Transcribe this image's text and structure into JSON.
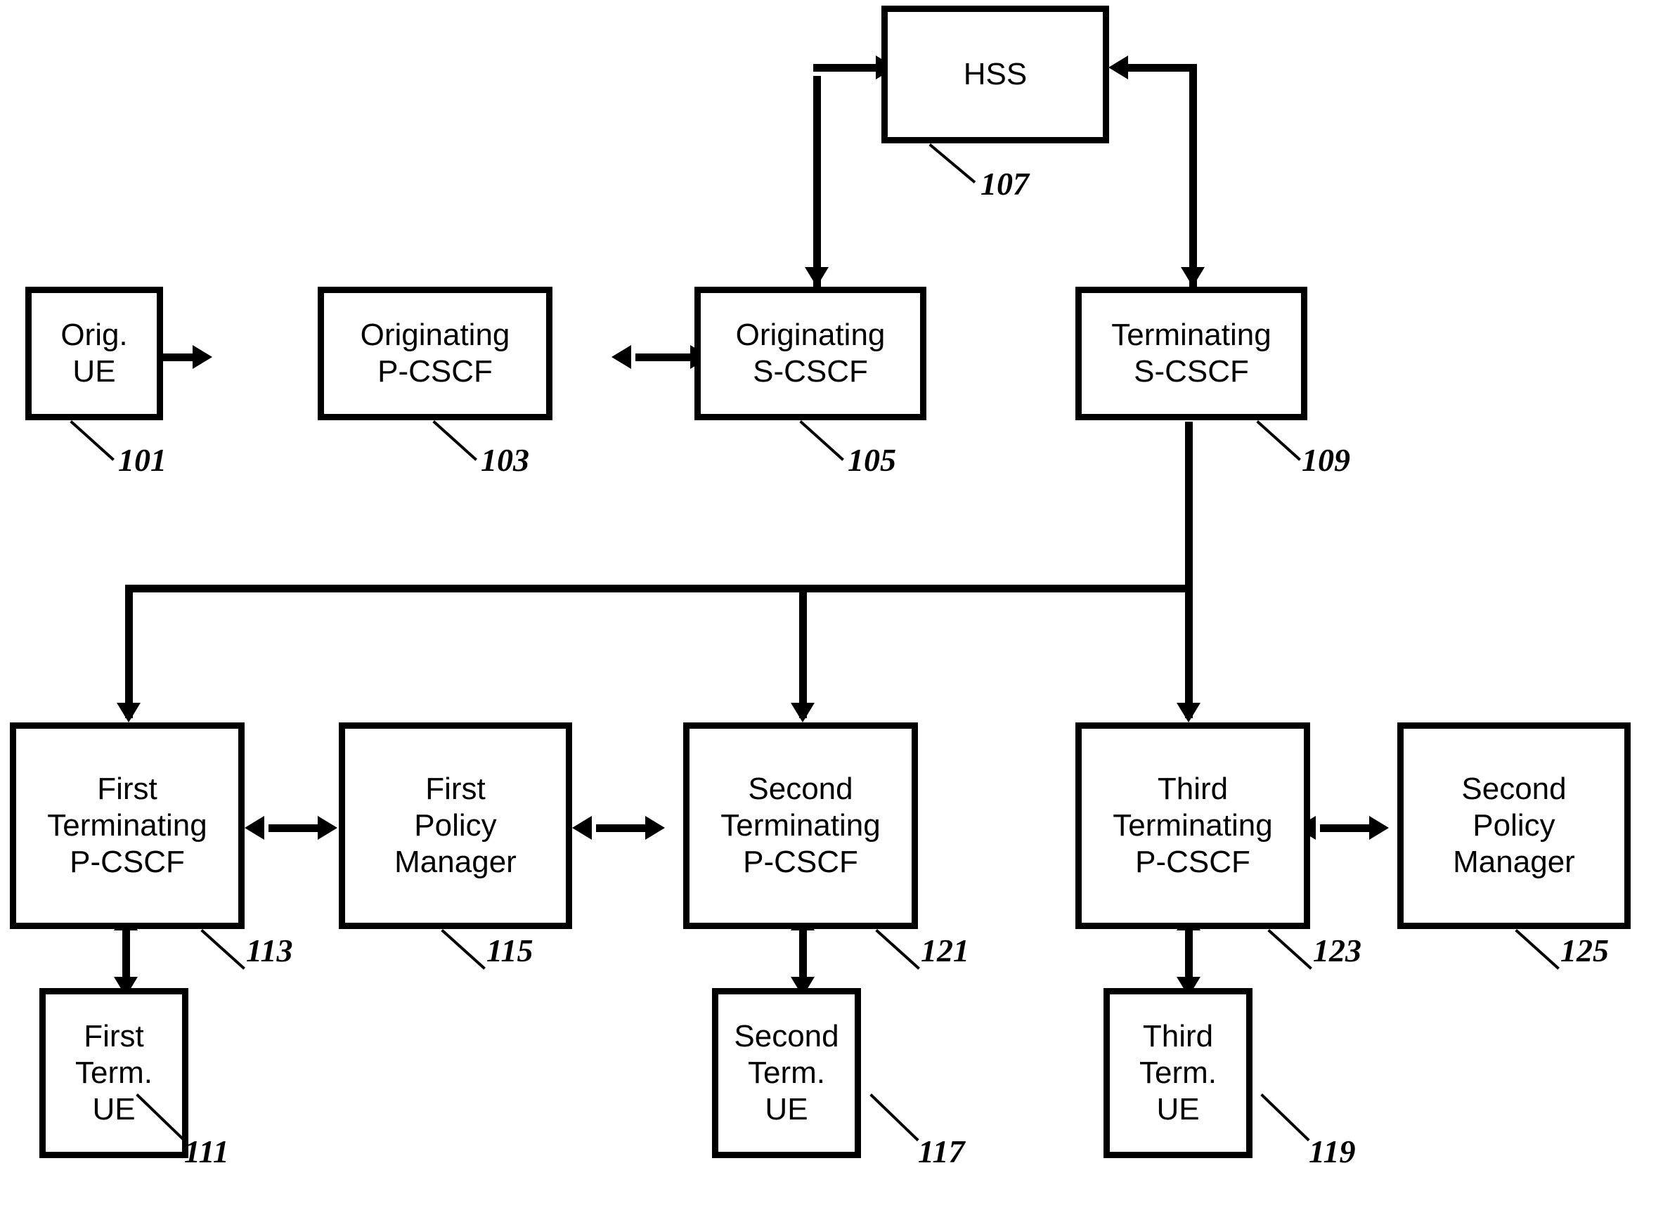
{
  "figure": {
    "type": "patent-block-diagram",
    "title": "IMS network elements block diagram"
  },
  "nodes": [
    {
      "id": "orig_ue",
      "label": "Orig.\nUE",
      "ref": "101"
    },
    {
      "id": "orig_pcscf",
      "label": "Originating\nP-CSCF",
      "ref": "103"
    },
    {
      "id": "orig_scscf",
      "label": "Originating\nS-CSCF",
      "ref": "105"
    },
    {
      "id": "hss",
      "label": "HSS",
      "ref": "107"
    },
    {
      "id": "term_scscf",
      "label": "Terminating\nS-CSCF",
      "ref": "109"
    },
    {
      "id": "first_ue",
      "label": "First\nTerm.\nUE",
      "ref": "111"
    },
    {
      "id": "first_pcscf",
      "label": "First\nTerminating\nP-CSCF",
      "ref": "113"
    },
    {
      "id": "first_pm",
      "label": "First\nPolicy\nManager",
      "ref": "115"
    },
    {
      "id": "second_ue",
      "label": "Second\nTerm.\nUE",
      "ref": "117"
    },
    {
      "id": "third_ue",
      "label": "Third\nTerm.\nUE",
      "ref": "119"
    },
    {
      "id": "second_pcscf",
      "label": "Second\nTerminating\nP-CSCF",
      "ref": "121"
    },
    {
      "id": "third_pcscf",
      "label": "Third\nTerminating\nP-CSCF",
      "ref": "123"
    },
    {
      "id": "second_pm",
      "label": "Second\nPolicy\nManager",
      "ref": "125"
    }
  ],
  "connections": [
    {
      "from": "orig_ue",
      "to": "orig_pcscf",
      "style": "bidirectional"
    },
    {
      "from": "orig_pcscf",
      "to": "orig_scscf",
      "style": "bidirectional"
    },
    {
      "from": "orig_scscf",
      "to": "term_scscf",
      "style": "bidirectional"
    },
    {
      "from": "orig_scscf",
      "to": "hss",
      "style": "bidirectional-elbow"
    },
    {
      "from": "term_scscf",
      "to": "hss",
      "style": "bidirectional-elbow"
    },
    {
      "from": "term_scscf",
      "to": "first_pcscf",
      "style": "bus-branch"
    },
    {
      "from": "term_scscf",
      "to": "second_pcscf",
      "style": "bus-branch"
    },
    {
      "from": "term_scscf",
      "to": "third_pcscf",
      "style": "bus-branch"
    },
    {
      "from": "first_pcscf",
      "to": "first_pm",
      "style": "bidirectional"
    },
    {
      "from": "first_pm",
      "to": "second_pcscf",
      "style": "bidirectional"
    },
    {
      "from": "third_pcscf",
      "to": "second_pm",
      "style": "bidirectional"
    },
    {
      "from": "first_pcscf",
      "to": "first_ue",
      "style": "bidirectional"
    },
    {
      "from": "second_pcscf",
      "to": "second_ue",
      "style": "bidirectional"
    },
    {
      "from": "third_pcscf",
      "to": "third_ue",
      "style": "bidirectional"
    }
  ],
  "colors": {
    "line": "#000000",
    "box_fill": "#ffffff",
    "background": "#ffffff",
    "text": "#000000"
  }
}
